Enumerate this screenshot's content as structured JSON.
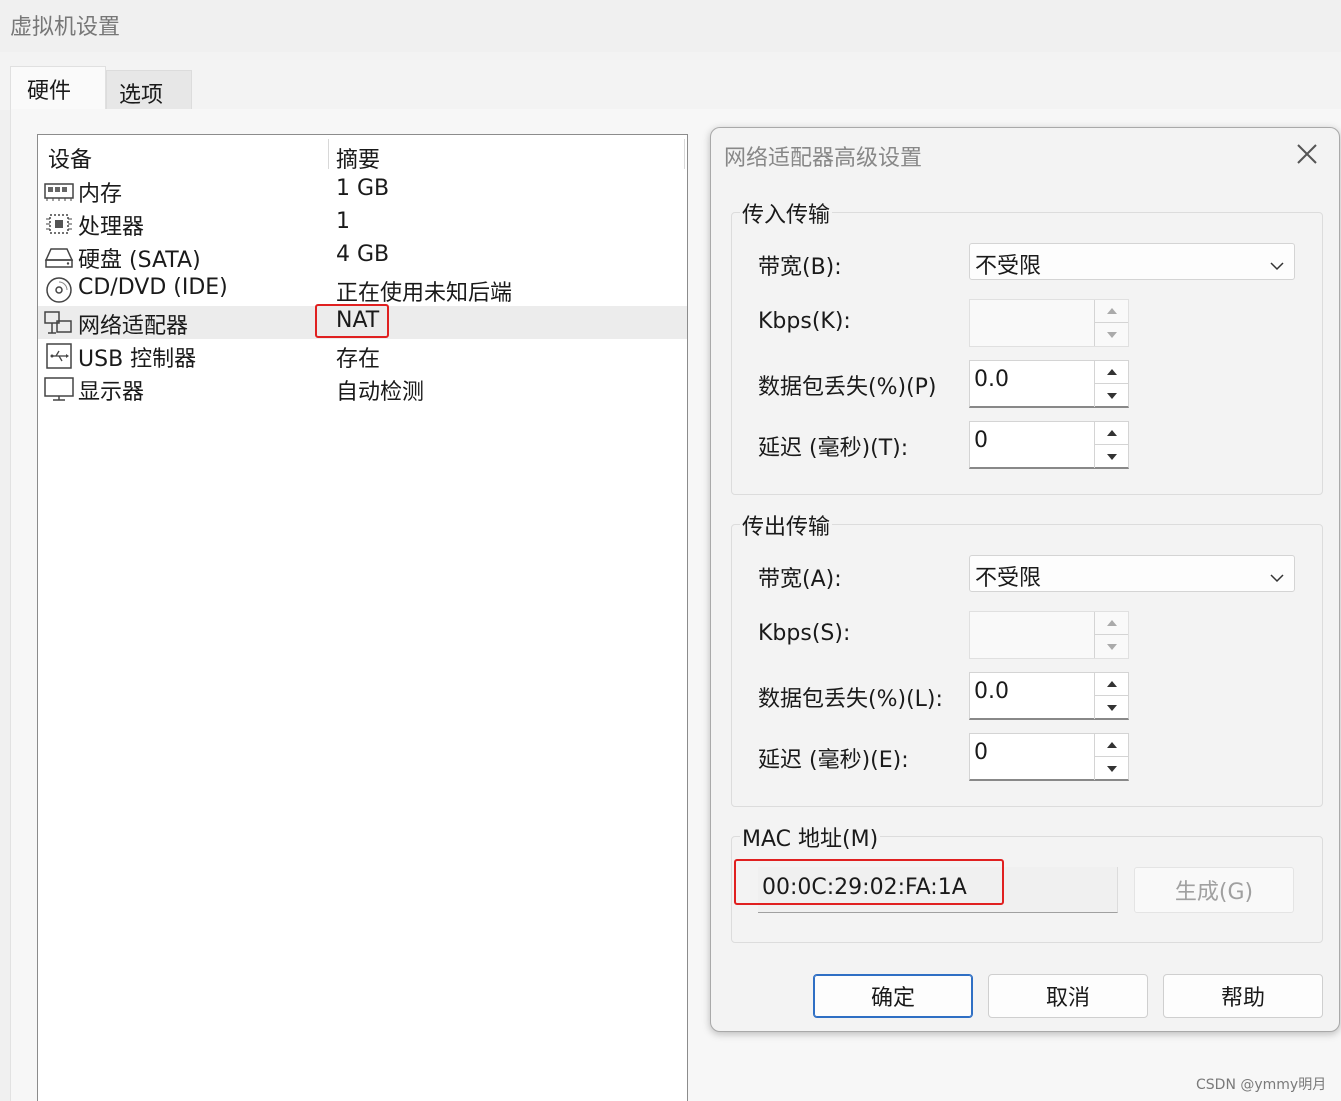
{
  "window": {
    "title": "虚拟机设置"
  },
  "tabs": [
    {
      "label": "硬件",
      "active": true
    },
    {
      "label": "选项",
      "active": false
    }
  ],
  "device_list": {
    "columns": [
      "设备",
      "摘要"
    ],
    "rows": [
      {
        "icon": "memory-icon",
        "name": "内存",
        "summary": "1 GB"
      },
      {
        "icon": "processor-icon",
        "name": "处理器",
        "summary": "1"
      },
      {
        "icon": "hard-disk-icon",
        "name": "硬盘 (SATA)",
        "summary": "4 GB"
      },
      {
        "icon": "cd-dvd-icon",
        "name": "CD/DVD (IDE)",
        "summary": "正在使用未知后端"
      },
      {
        "icon": "network-adapter-icon",
        "name": "网络适配器",
        "summary": "NAT",
        "selected": true
      },
      {
        "icon": "usb-icon",
        "name": "USB 控制器",
        "summary": "存在"
      },
      {
        "icon": "display-icon",
        "name": "显示器",
        "summary": "自动检测"
      }
    ]
  },
  "dialog": {
    "title": "网络适配器高级设置",
    "incoming": {
      "label": "传入传输",
      "bandwidth_label": "带宽(B):",
      "bandwidth_value": "不受限",
      "kbps_label": "Kbps(K):",
      "kbps_value": "",
      "loss_label": "数据包丢失(%)(P)",
      "loss_value": "0.0",
      "latency_label": "延迟 (毫秒)(T):",
      "latency_value": "0"
    },
    "outgoing": {
      "label": "传出传输",
      "bandwidth_label": "带宽(A):",
      "bandwidth_value": "不受限",
      "kbps_label": "Kbps(S):",
      "kbps_value": "",
      "loss_label": "数据包丢失(%)(L):",
      "loss_value": "0.0",
      "latency_label": "延迟 (毫秒)(E):",
      "latency_value": "0"
    },
    "mac": {
      "label": "MAC 地址(M)",
      "value": "00:0C:29:02:FA:1A",
      "generate_label": "生成(G)"
    },
    "buttons": {
      "ok": "确定",
      "cancel": "取消",
      "help": "帮助"
    }
  },
  "watermark": "CSDN @ymmy明月",
  "colors": {
    "highlight_box": "#e02020",
    "primary_border": "#2f6fc4"
  }
}
